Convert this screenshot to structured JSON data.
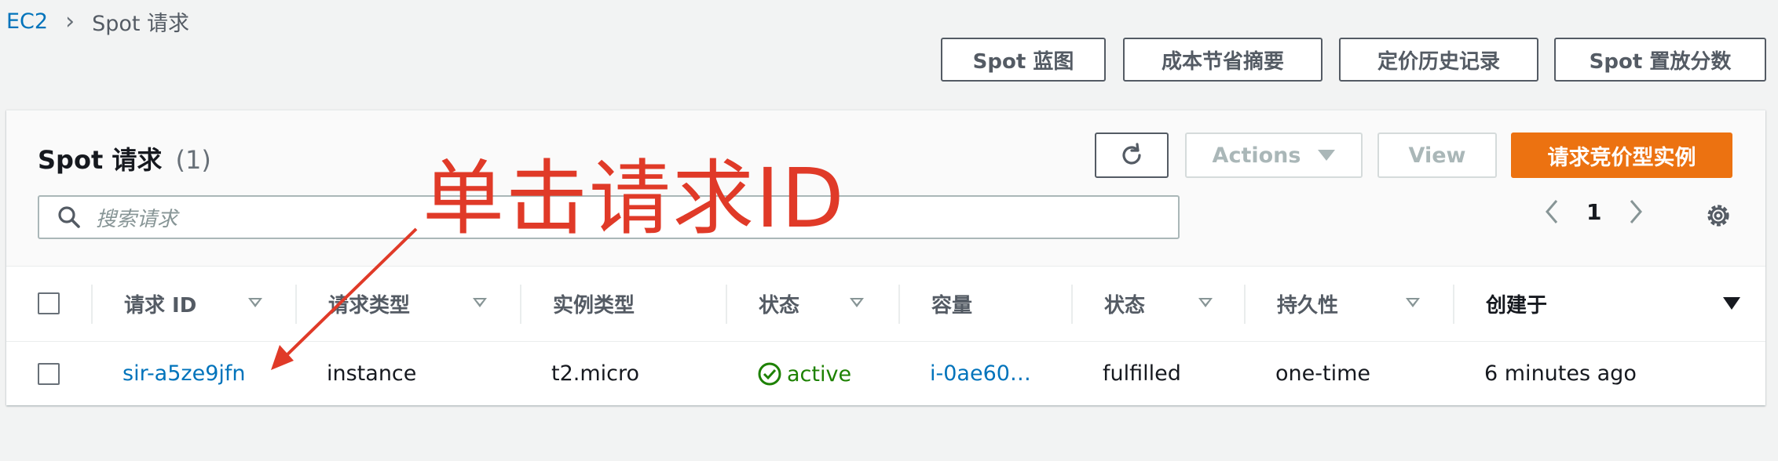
{
  "breadcrumb": {
    "root": "EC2",
    "current": "Spot 请求"
  },
  "top_buttons": [
    "Spot 蓝图",
    "成本节省摘要",
    "定价历史记录",
    "Spot 置放分数"
  ],
  "panel": {
    "title": "Spot 请求",
    "count": "(1)",
    "actions_label": "Actions",
    "view_label": "View",
    "primary_label": "请求竞价型实例",
    "search_placeholder": "搜索请求",
    "page": "1"
  },
  "table": {
    "headers": [
      "请求 ID",
      "请求类型",
      "实例类型",
      "状态",
      "容量",
      "状态",
      "持久性",
      "创建于"
    ],
    "row": {
      "request_id": "sir-a5ze9jfn",
      "request_type": "instance",
      "instance_type": "t2.micro",
      "state": "active",
      "capacity": "i-0ae60…",
      "status": "fulfilled",
      "persistence": "one-time",
      "created": "6 minutes ago"
    }
  },
  "annotation": "单击请求ID",
  "colors": {
    "link": "#0073bb",
    "primary": "#ec7211",
    "active": "#1d8102",
    "annotation": "#e03a28"
  }
}
